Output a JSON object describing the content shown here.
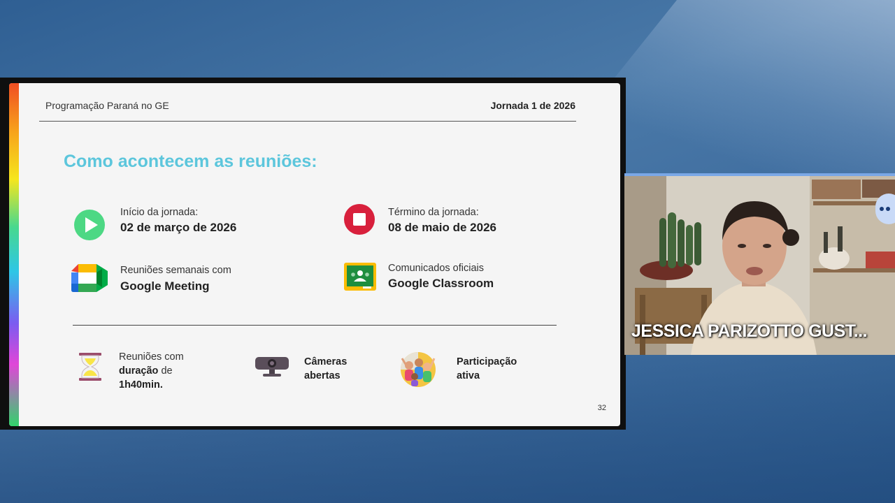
{
  "slide": {
    "header_left": "Programação Paraná no GE",
    "header_right": "Jornada 1 de 2026",
    "title": "Como acontecem as reuniões:",
    "start": {
      "label": "Início da jornada:",
      "value": "02 de março de 2026",
      "icon": "play-icon"
    },
    "end": {
      "label": "Término da jornada:",
      "value": "08 de maio de 2026",
      "icon": "stop-icon"
    },
    "meet": {
      "label": "Reuniões semanais com",
      "value": "Google Meeting",
      "icon": "google-meet-icon"
    },
    "classroom": {
      "label": "Comunicados oficiais",
      "value": "Google Classroom",
      "icon": "google-classroom-icon"
    },
    "duration": {
      "line1": "Reuniões com",
      "line2_bold": "duração",
      "line2_rest": " de",
      "line3": "1h40min.",
      "icon": "hourglass-icon"
    },
    "cameras": {
      "line1": "Câmeras",
      "line2": "abertas",
      "icon": "webcam-icon"
    },
    "participation": {
      "line1": "Participação",
      "line2": "ativa",
      "icon": "people-group-icon"
    },
    "page_number": "32"
  },
  "participant": {
    "name": "JESSICA PARIZOTTO GUST...",
    "more_icon": "more-options-icon"
  },
  "colors": {
    "title": "#5cc6dc",
    "play": "#4dd884",
    "stop": "#d8203c",
    "tile_border": "#7aa7e6"
  }
}
